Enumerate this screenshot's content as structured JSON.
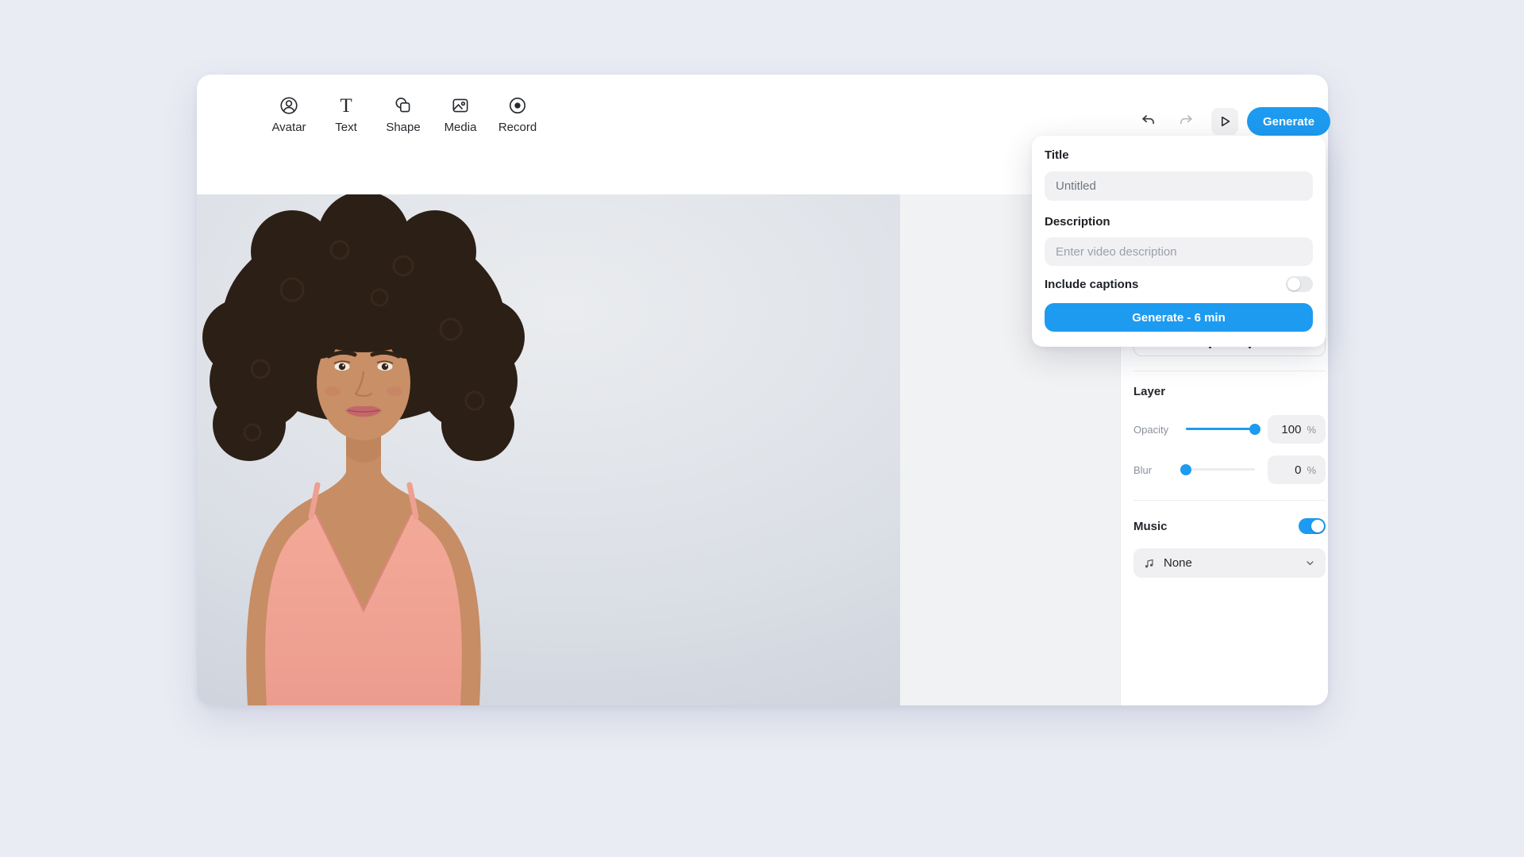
{
  "app": {
    "accent_color": "#1d9bf0",
    "page_background": "#eaecf4",
    "workspace_background": "#f1f2f3"
  },
  "toolbar": {
    "items": [
      {
        "label": "Avatar",
        "icon": "avatar-icon"
      },
      {
        "label": "Text",
        "icon": "text-icon"
      },
      {
        "label": "Shape",
        "icon": "shape-icon"
      },
      {
        "label": "Media",
        "icon": "media-icon"
      },
      {
        "label": "Record",
        "icon": "record-icon"
      }
    ]
  },
  "header_actions": {
    "undo_icon": "undo-icon",
    "redo_icon": "redo-icon",
    "play_icon": "play-icon",
    "generate_label": "Generate"
  },
  "generate_popover": {
    "title_label": "Title",
    "title_value": "Untitled",
    "description_label": "Description",
    "description_placeholder": "Enter video description",
    "captions_label": "Include captions",
    "captions_enabled": false,
    "generate_button_label": "Generate - 6 min"
  },
  "inspector": {
    "layer": {
      "heading": "Layer",
      "opacity_label": "Opacity",
      "opacity_value": "100",
      "opacity_unit": "%",
      "opacity_percent": 100,
      "blur_label": "Blur",
      "blur_value": "0",
      "blur_unit": "%",
      "blur_percent": 0
    },
    "music": {
      "heading": "Music",
      "enabled": true,
      "selected": "None",
      "icon": "music-note-icon",
      "chevron": "chevron-down-icon"
    }
  },
  "canvas": {
    "description": "Woman with dark curly hair wearing a pink camisole against a gray studio background"
  }
}
